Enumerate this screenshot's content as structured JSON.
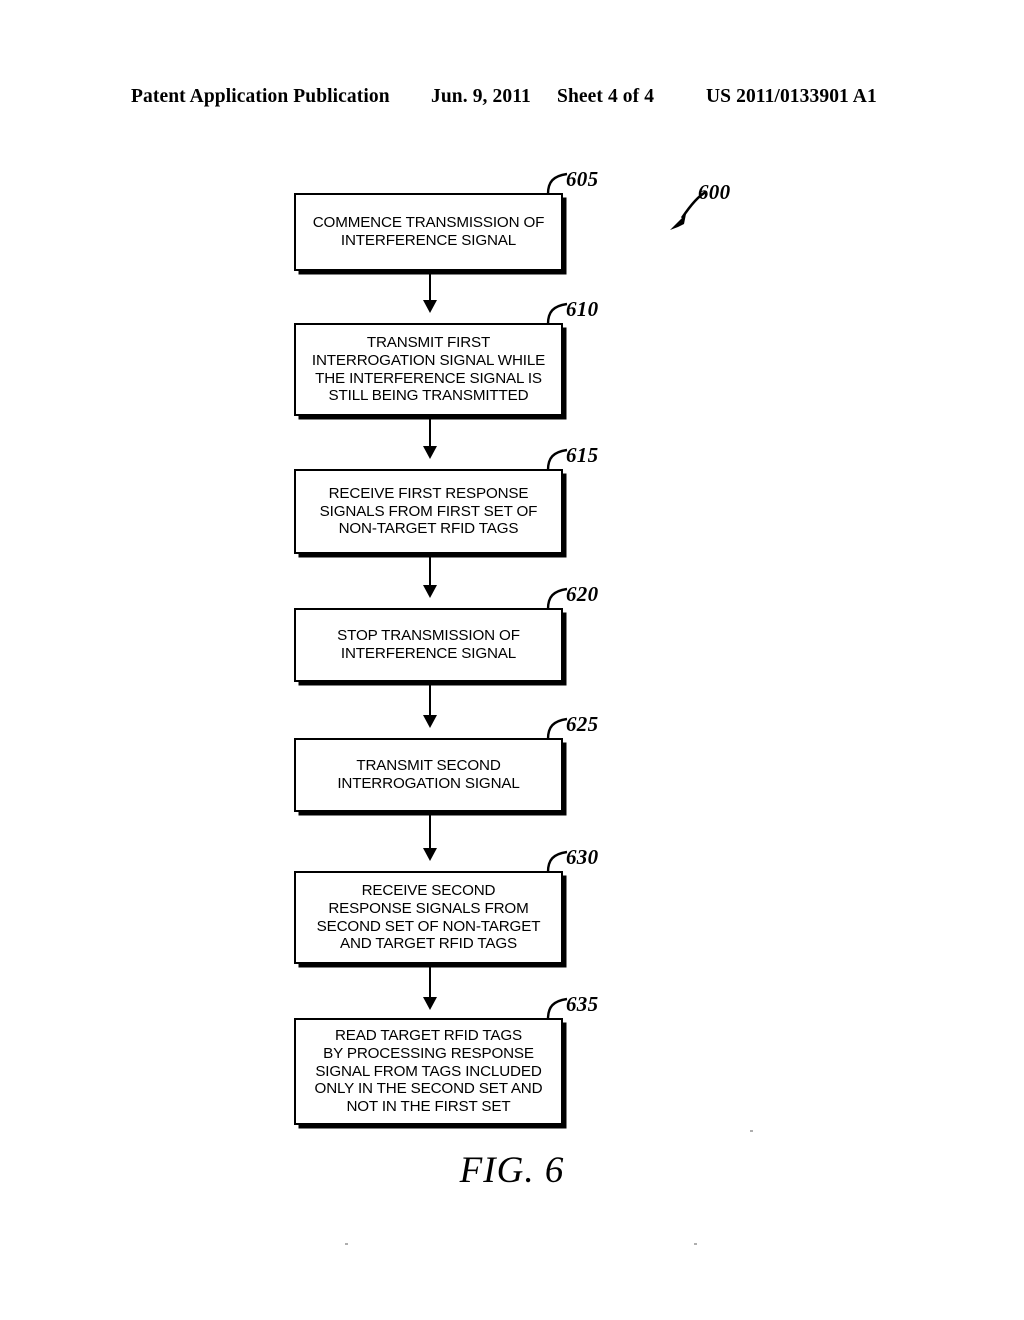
{
  "header": {
    "publication": "Patent Application Publication",
    "date": "Jun. 9, 2011",
    "sheet": "Sheet 4 of 4",
    "patent_number": "US 2011/0133901 A1"
  },
  "figure": {
    "caption": "FIG. 6",
    "diagram_label": "600"
  },
  "flowchart": {
    "type": "flowchart",
    "orientation": "vertical",
    "nodes": [
      {
        "ref": "605",
        "text": "COMMENCE TRANSMISSION OF\nINTERFERENCE SIGNAL"
      },
      {
        "ref": "610",
        "text": "TRANSMIT FIRST\nINTERROGATION SIGNAL WHILE\nTHE INTERFERENCE SIGNAL IS\nSTILL BEING TRANSMITTED"
      },
      {
        "ref": "615",
        "text": "RECEIVE FIRST RESPONSE\nSIGNALS FROM FIRST SET OF\nNON-TARGET RFID TAGS"
      },
      {
        "ref": "620",
        "text": "STOP TRANSMISSION OF\nINTERFERENCE SIGNAL"
      },
      {
        "ref": "625",
        "text": "TRANSMIT SECOND\nINTERROGATION SIGNAL"
      },
      {
        "ref": "630",
        "text": "RECEIVE SECOND\nRESPONSE SIGNALS FROM\nSECOND SET OF NON-TARGET\nAND TARGET RFID TAGS"
      },
      {
        "ref": "635",
        "text": "READ TARGET RFID TAGS\nBY PROCESSING RESPONSE\nSIGNAL FROM TAGS INCLUDED\nONLY IN THE SECOND SET AND\nNOT IN THE FIRST SET"
      }
    ]
  }
}
